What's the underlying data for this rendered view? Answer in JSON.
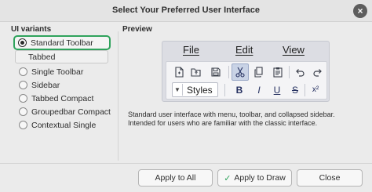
{
  "window": {
    "title": "Select Your Preferred User Interface",
    "close_icon": "close-icon"
  },
  "variants_section": {
    "label": "UI variants",
    "items": [
      {
        "label": "Standard Toolbar",
        "selected": true
      },
      {
        "label": "Tabbed",
        "selected": false
      },
      {
        "label": "Single Toolbar",
        "selected": false
      },
      {
        "label": "Sidebar",
        "selected": false
      },
      {
        "label": "Tabbed Compact",
        "selected": false
      },
      {
        "label": "Groupedbar Compact",
        "selected": false
      },
      {
        "label": "Contextual Single",
        "selected": false
      }
    ]
  },
  "preview_section": {
    "label": "Preview",
    "menu": {
      "file": "File",
      "edit": "Edit",
      "view": "View"
    },
    "toolbar_icons": [
      "new-document-icon",
      "open-folder-icon",
      "save-icon",
      "cut-icon",
      "copy-icon",
      "paste-icon",
      "undo-icon",
      "redo-icon"
    ],
    "styles_value": "Styles",
    "format": {
      "bold": "B",
      "italic": "I",
      "underline": "U",
      "strikethrough": "S",
      "superscript": "x²"
    },
    "description": "Standard user interface with menu, toolbar, and collapsed sidebar. Intended for users who are familiar with the classic interface."
  },
  "buttons": {
    "apply_all": "Apply to All",
    "apply_draw": "Apply to Draw",
    "close": "Close"
  },
  "colors": {
    "accent": "#2fa35c",
    "preview_bg": "#dcdde3",
    "dialog_bg": "#ebebeb"
  }
}
